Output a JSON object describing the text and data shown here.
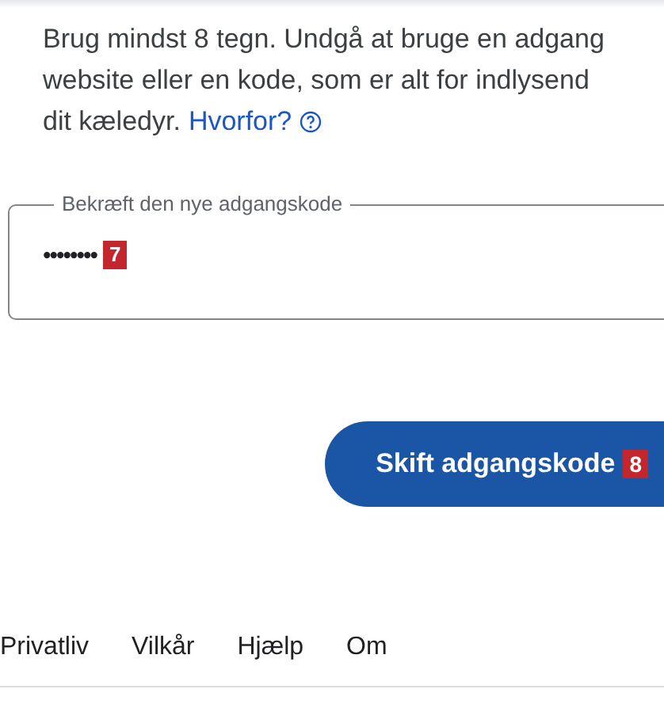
{
  "intro": {
    "lines": [
      "Brug mindst 8 tegn. Undgå at bruge en adgang",
      "website eller en kode, som er alt for indlysend",
      "dit kæledyr."
    ],
    "link": "Hvorfor?"
  },
  "confirm_field": {
    "label": "Bekræft den nye adgangskode",
    "value": "••••••••",
    "badge": "7"
  },
  "submit": {
    "label": "Skift adgangskode",
    "badge": "8"
  },
  "footer": {
    "links": [
      "Privatliv",
      "Vilkår",
      "Hjælp",
      "Om"
    ]
  }
}
